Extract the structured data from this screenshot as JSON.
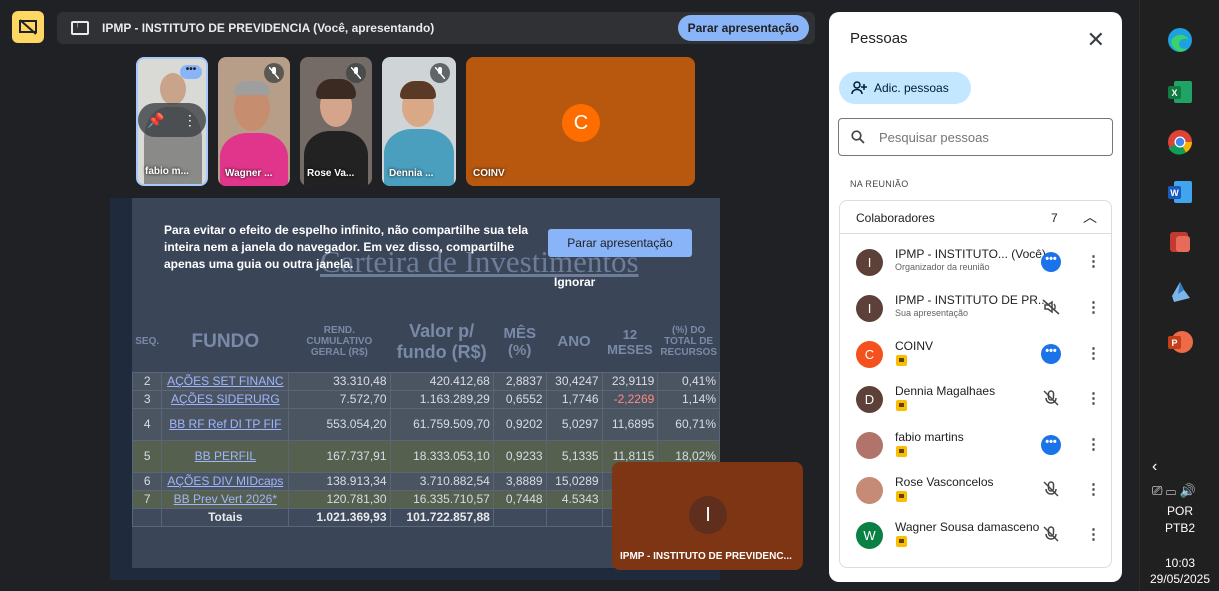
{
  "presentation_bar": {
    "title": "IPMP - INSTITUTO DE PREVIDENCIA (Você, apresentando)",
    "stop_button": "Parar apresentação"
  },
  "tiles": [
    {
      "name": "fabio m..."
    },
    {
      "name": "Wagner ..."
    },
    {
      "name": "Rose Va..."
    },
    {
      "name": "Dennia ..."
    },
    {
      "name": "COINV",
      "initial": "C"
    }
  ],
  "shared_screen": {
    "sheet_title": "Carteira de Investimentos",
    "warning": "Para evitar o efeito de espelho infinito, não compartilhe sua tela inteira nem a janela do navegador. Em vez disso, compartilhe apenas uma guia ou outra janela.",
    "stop_button": "Parar apresentação",
    "ignore_button": "Ignorar",
    "headers": [
      "SEQ.",
      "FUNDO",
      "REND. CUMULATIVO GERAL (R$)",
      "Valor p/ fundo (R$)",
      "MÊS (%)",
      "ANO",
      "12 MESES",
      "(%) DO TOTAL DE RECURSOS"
    ],
    "rows": [
      [
        "2",
        "AÇÕES SET FINANC",
        "33.310,48",
        "420.412,68",
        "2,8837",
        "30,4247",
        "23,9119",
        "0,41%"
      ],
      [
        "3",
        "AÇÕES SIDERURG",
        "7.572,70",
        "1.163.289,29",
        "0,6552",
        "1,7746",
        "-2,2269",
        "1,14%"
      ],
      [
        "4",
        "BB RF Ref DI TP FIF",
        "553.054,20",
        "61.759.509,70",
        "0,9202",
        "5,0297",
        "11,6895",
        "60,71%"
      ],
      [
        "5",
        "BB PERFIL",
        "167.737,91",
        "18.333.053,10",
        "0,9233",
        "5,1335",
        "11,8115",
        "18,02%"
      ],
      [
        "6",
        "AÇÕES DIV MIDcaps",
        "138.913,34",
        "3.710.882,54",
        "3,8889",
        "15,0289",
        "",
        ""
      ],
      [
        "7",
        "BB Prev Vert 2026*",
        "120.781,30",
        "16.335.710,57",
        "0,7448",
        "4.5343",
        "",
        ""
      ]
    ],
    "totals": {
      "label": "Totais",
      "rend": "1.021.369,93",
      "valor": "101.722.857,88"
    }
  },
  "self_tile": {
    "initial": "I",
    "name": "IPMP - INSTITUTO DE PREVIDENC..."
  },
  "people_panel": {
    "title": "Pessoas",
    "add_people": "Adic. pessoas",
    "search_placeholder": "Pesquisar pessoas",
    "section_label": "NA REUNIÃO",
    "group_label": "Colaboradores",
    "group_count": "7",
    "people": [
      {
        "name": "IPMP - INSTITUTO... (Você)",
        "sub": "Organizador da reunião",
        "initial": "I",
        "color": "#5d4037",
        "status": "more"
      },
      {
        "name": "IPMP - INSTITUTO DE PR...",
        "sub": "Sua apresentação",
        "initial": "I",
        "color": "#5d4037",
        "status": "present"
      },
      {
        "name": "COINV",
        "sub": "",
        "initial": "C",
        "color": "#f4511e",
        "status": "more"
      },
      {
        "name": "Dennia Magalhaes",
        "sub": "",
        "initial": "D",
        "color": "#5d4037",
        "status": "muted"
      },
      {
        "name": "fabio martins",
        "sub": "",
        "initial": "",
        "color": "#b0746a",
        "status": "more"
      },
      {
        "name": "Rose Vasconcelos",
        "sub": "",
        "initial": "",
        "color": "#c58b76",
        "status": "muted"
      },
      {
        "name": "Wagner Sousa damasceno",
        "sub": "",
        "initial": "W",
        "color": "#0b8043",
        "status": "muted"
      }
    ]
  },
  "taskbar": {
    "lang_1": "POR",
    "lang_2": "PTB2",
    "time": "10:03",
    "date": "29/05/2025"
  }
}
